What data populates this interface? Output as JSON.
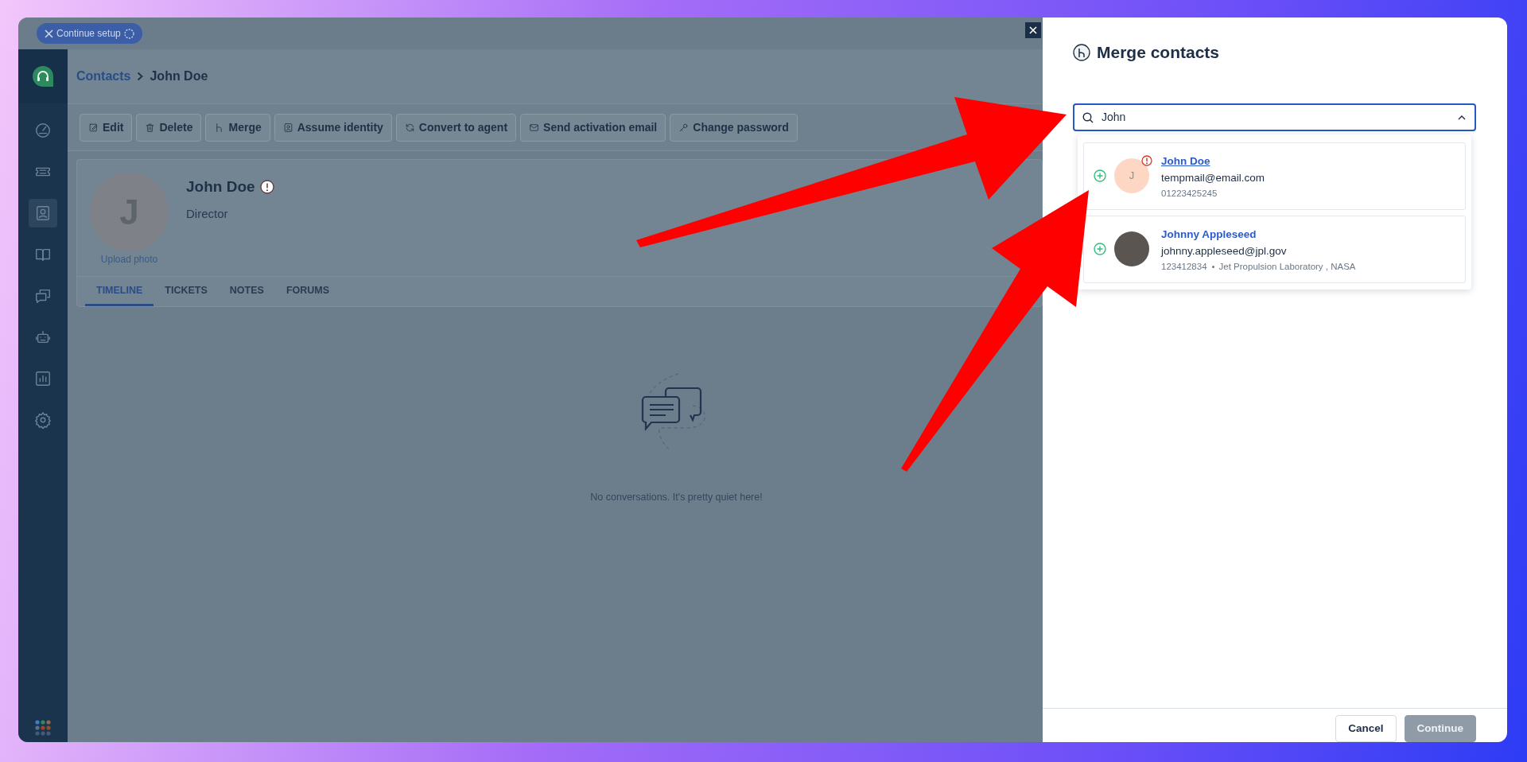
{
  "setup_button": {
    "label": "Continue setup"
  },
  "sidebar": {
    "items": [
      {
        "kind": "gauge",
        "selected": false
      },
      {
        "kind": "ticket",
        "selected": false
      },
      {
        "kind": "contact",
        "selected": true
      },
      {
        "kind": "book",
        "selected": false
      },
      {
        "kind": "chat",
        "selected": false
      },
      {
        "kind": "robot",
        "selected": false
      },
      {
        "kind": "chart",
        "selected": false
      },
      {
        "kind": "gear",
        "selected": false
      }
    ]
  },
  "breadcrumb": [
    {
      "label": "Contacts",
      "kind": "link"
    },
    {
      "label": "John Doe",
      "kind": "current"
    }
  ],
  "toolbar": [
    {
      "label": "Edit",
      "kind": "edit"
    },
    {
      "label": "Delete",
      "kind": "trash"
    },
    {
      "label": "Merge",
      "kind": "merge"
    },
    {
      "label": "Assume identity",
      "kind": "badge"
    },
    {
      "label": "Convert to agent",
      "kind": "refresh"
    },
    {
      "label": "Send activation email",
      "kind": "envelope"
    },
    {
      "label": "Change password",
      "kind": "key"
    }
  ],
  "contact": {
    "avatar_initial": "J",
    "name": "John Doe",
    "warning": true,
    "title": "Director",
    "upload_label": "Upload photo"
  },
  "tabs": [
    {
      "label": "TIMELINE",
      "selected": true
    },
    {
      "label": "TICKETS",
      "selected": false
    },
    {
      "label": "NOTES",
      "selected": false
    },
    {
      "label": "FORUMS",
      "selected": false
    }
  ],
  "empty_state": {
    "message": "No conversations. It's pretty quiet here!"
  },
  "drawer": {
    "title": "Merge contacts",
    "search": {
      "value": "John"
    },
    "results": [
      {
        "name": "John Doe",
        "hovered": true,
        "email": "tempmail@email.com",
        "details": [
          "01223425245"
        ],
        "kind": "initial",
        "avatar_initial": "J",
        "warning": true
      },
      {
        "name": "Johnny Appleseed",
        "hovered": false,
        "email": "johnny.appleseed@jpl.gov",
        "details": [
          "123412834",
          "Jet Propulsion Laboratory , NASA"
        ],
        "kind": "photo",
        "warning": false
      }
    ],
    "buttons": [
      {
        "label": "Cancel",
        "disabled": false
      },
      {
        "label": "Continue",
        "disabled": true
      }
    ]
  }
}
